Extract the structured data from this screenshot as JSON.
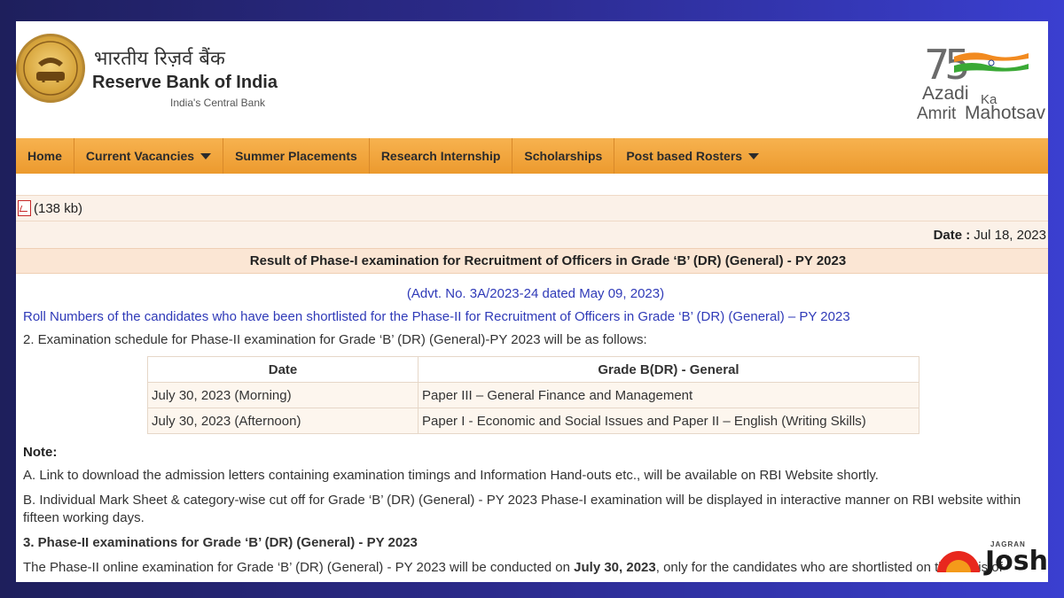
{
  "header": {
    "hindi_name": "भारतीय रिज़र्व बैंक",
    "bank_name": "Reserve Bank of India",
    "tagline": "India's Central Bank",
    "azadi_logo": {
      "number": "75",
      "line1": "Azadi",
      "line2": "Ka",
      "line3": "Amrit",
      "line4": "Mahotsav"
    }
  },
  "nav": {
    "items": [
      {
        "label": "Home",
        "dropdown": false
      },
      {
        "label": "Current Vacancies",
        "dropdown": true
      },
      {
        "label": "Summer Placements",
        "dropdown": false
      },
      {
        "label": "Research Internship",
        "dropdown": false
      },
      {
        "label": "Scholarships",
        "dropdown": false
      },
      {
        "label": "Post based Rosters",
        "dropdown": true
      }
    ]
  },
  "content": {
    "pdf_size": "(138 kb)",
    "date_label": "Date :",
    "date_value": "Jul 18, 2023",
    "title": "Result of Phase-I examination for Recruitment of Officers in Grade ‘B’ (DR) (General) - PY 2023",
    "advt": "(Advt. No. 3A/2023-24 dated May 09, 2023)",
    "shortlist_link": "Roll Numbers of the candidates who have been shortlisted for the Phase-II for Recruitment of Officers in Grade ‘B’ (DR) (General) – PY 2023",
    "schedule_intro": "2. Examination schedule for Phase-II examination for Grade ‘B’ (DR) (General)-PY 2023 will be as follows:",
    "table": {
      "headers": [
        "Date",
        "Grade B(DR) - General"
      ],
      "rows": [
        [
          "July 30, 2023 (Morning)",
          "Paper III – General Finance and Management"
        ],
        [
          "July 30, 2023 (Afternoon)",
          "Paper I - Economic and Social Issues and Paper II – English (Writing Skills)"
        ]
      ]
    },
    "note_heading": "Note:",
    "note_a": "A. Link to download the admission letters containing examination timings and Information Hand-outs etc., will be available on RBI Website shortly.",
    "note_b": "B. Individual Mark Sheet & category-wise cut off for Grade ‘B’ (DR) (General) - PY 2023 Phase-I examination will be displayed in interactive manner on RBI website within fifteen working days.",
    "section3_heading": "3. Phase-II examinations for Grade ‘B’ (DR) (General) - PY 2023",
    "section3_text_pre": "The Phase-II online examination for Grade ‘B’ (DR) (General) - PY 2023 will be conducted on ",
    "section3_date": "July 30, 2023",
    "section3_text_post": ", only for the candidates who are shortlisted on the basis of"
  },
  "watermark": {
    "top": "JAGRAN",
    "brand": "Josh"
  },
  "colors": {
    "nav_bg": "#ec9a2e",
    "link": "#2f3ab8",
    "title_bg": "#fbe6d4",
    "background": "#2b2a8a"
  }
}
